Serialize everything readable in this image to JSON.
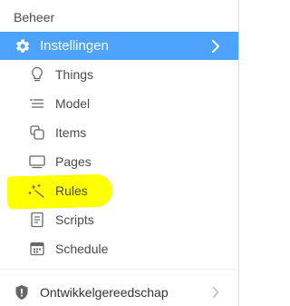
{
  "section": {
    "title": "Beheer"
  },
  "settings": {
    "label": "Instellingen",
    "icon": "gear-icon",
    "accent": "#4da3ff"
  },
  "items": [
    {
      "label": "Things",
      "icon": "lightbulb-icon"
    },
    {
      "label": "Model",
      "icon": "list-icon"
    },
    {
      "label": "Items",
      "icon": "copy-icon"
    },
    {
      "label": "Pages",
      "icon": "monitor-icon"
    },
    {
      "label": "Rules",
      "icon": "magic-wand-icon"
    },
    {
      "label": "Scripts",
      "icon": "document-icon"
    },
    {
      "label": "Schedule",
      "icon": "calendar-icon"
    }
  ],
  "developer": {
    "label": "Ontwikkelgereedschap",
    "icon": "shield-icon"
  },
  "highlight_color": "#ffff00"
}
